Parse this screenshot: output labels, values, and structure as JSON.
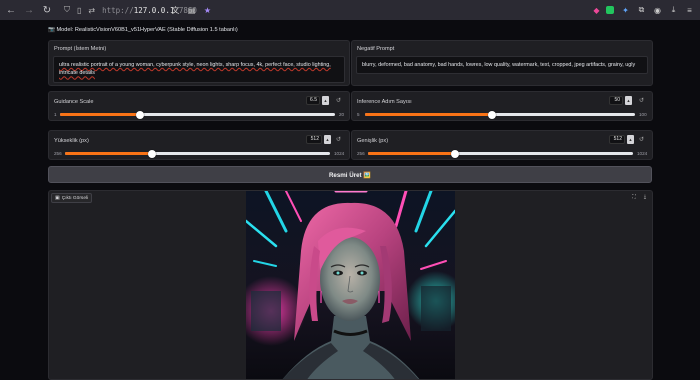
{
  "browser": {
    "url_prefix": "http://",
    "url_host": "127.0.0.1",
    "url_port": ":7860"
  },
  "model_line": "📷 Model: RealisticVisionV60B1_v51HyperVAE (Stable Diffusion 1.5 tabanlı)",
  "prompt": {
    "label": "Prompt (İstem Metni)",
    "value_line1": "ultra realistic portrait of a young woman, cyberpunk style, neon lights, sharp focus, 4k, perfect face, studio lighting,",
    "value_line2": "intricate details"
  },
  "negative_prompt": {
    "label": "Negatif Prompt",
    "value": "blurry, deformed, bad anatomy, bad hands, lowres, low quality, watermark, text, cropped, jpeg artifacts, grainy, ugly"
  },
  "guidance": {
    "label": "Guidance Scale",
    "value": "6.5",
    "min": "1",
    "max": "20",
    "fraction": 0.29
  },
  "steps": {
    "label": "Inference Adım Sayısı",
    "value": "50",
    "min": "5",
    "max": "100",
    "fraction": 0.47
  },
  "height": {
    "label": "Yükseklik (px)",
    "value": "512",
    "min": "256",
    "max": "1024",
    "fraction": 0.33
  },
  "width": {
    "label": "Genişlik (px)",
    "value": "512",
    "min": "256",
    "max": "1024",
    "fraction": 0.33
  },
  "generate_button": "Resmi Üret 🖼️",
  "output": {
    "label": "Çıktı Görseli"
  },
  "colors": {
    "accent": "#f97316",
    "panel": "#1f1f23",
    "page": "#0b0b0f"
  },
  "icons": {
    "back": "back-arrow-icon",
    "forward": "forward-arrow-icon",
    "reload": "reload-icon",
    "shield": "shield-icon",
    "page": "page-icon",
    "translate": "translate-icon",
    "star": "bookmark-star-icon",
    "reset": "reset-icon",
    "image": "image-icon",
    "fullscreen": "fullscreen-icon",
    "download": "download-icon"
  }
}
